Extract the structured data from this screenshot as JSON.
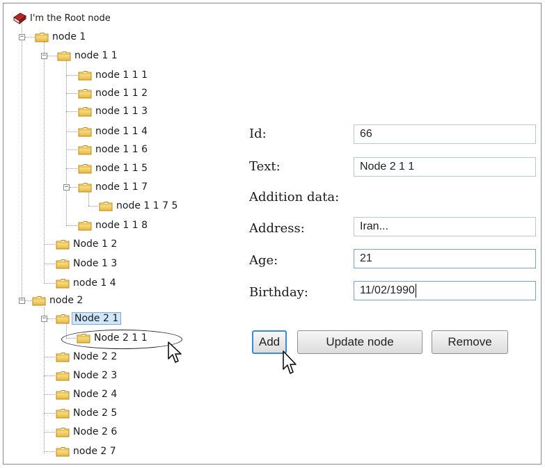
{
  "tree": {
    "root": "I'm the Root node",
    "items": [
      "node 1",
      "node 1 1",
      "node 1 1 1",
      "node 1 1 2",
      "node 1 1 3",
      "node 1 1 4",
      "node 1 1 6",
      "node 1 1 5",
      "node 1 1 7",
      "node 1 1 7 5",
      "node 1 1 8",
      "Node 1 2",
      "Node 1 3",
      "node 1 4",
      "node 2",
      "Node 2 1",
      "Node 2 1 1",
      "Node 2 2",
      "Node 2 3",
      "Node 2 4",
      "Node 2 5",
      "Node 2 6",
      "node 2 7"
    ],
    "toggle_minus": "−"
  },
  "form": {
    "id_label": "Id:",
    "id_value": "66",
    "text_label": "Text:",
    "text_value": "Node 2 1 1",
    "addition_label": "Addition data:",
    "address_label": "Address:",
    "address_value": "Iran...",
    "age_label": "Age:",
    "age_value": "21",
    "birthday_label": "Birthday:",
    "birthday_value": "11/02/1990"
  },
  "buttons": {
    "add": "Add",
    "update": "Update node",
    "remove": "Remove"
  }
}
